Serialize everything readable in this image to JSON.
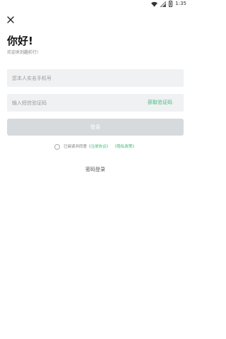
{
  "status_bar": {
    "time": "1:35",
    "icons": [
      "wifi-icon",
      "signal-icon",
      "battery-icon"
    ]
  },
  "close_icon": "close-icon",
  "header": {
    "title": "你好!",
    "subtitle": "欢迎来到趣前行!"
  },
  "form": {
    "phone_placeholder": "您本人实名手机号",
    "code_placeholder": "输入短信验证码",
    "get_code_label": "获取验证码",
    "login_label": "登录"
  },
  "agreement": {
    "prefix": "已阅读并同意",
    "service_link": "《注册协议》",
    "privacy_link": "《隐私政策》"
  },
  "alt_login_label": "密码登录",
  "colors": {
    "accent": "#3dbb7a",
    "disabled_button": "#d7dadd",
    "field_background": "#f0f1f3"
  }
}
